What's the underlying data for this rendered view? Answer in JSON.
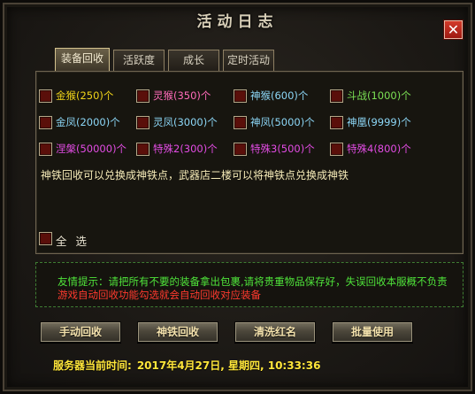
{
  "window": {
    "title": "活动日志",
    "close_label": "✕"
  },
  "tabs": [
    {
      "label": "装备回收",
      "active": true
    },
    {
      "label": "活跃度",
      "active": false
    },
    {
      "label": "成长",
      "active": false
    },
    {
      "label": "定时活动",
      "active": false
    }
  ],
  "items": [
    {
      "label": "金猴(250)个",
      "color": "#f0d419",
      "checked": false
    },
    {
      "label": "灵猴(350)个",
      "color": "#ff6bb9",
      "checked": false
    },
    {
      "label": "神猴(600)个",
      "color": "#8cd6f6",
      "checked": false
    },
    {
      "label": "斗战(1000)个",
      "color": "#7be054",
      "checked": false
    },
    {
      "label": "金凤(2000)个",
      "color": "#8cd6f6",
      "checked": false
    },
    {
      "label": "灵凤(3000)个",
      "color": "#8cd6f6",
      "checked": false
    },
    {
      "label": "神凤(5000)个",
      "color": "#8cd6f6",
      "checked": false
    },
    {
      "label": "神凰(9999)个",
      "color": "#8cd6f6",
      "checked": false
    },
    {
      "label": "涅槃(50000)个",
      "color": "#e34ce4",
      "checked": false
    },
    {
      "label": "特殊2(300)个",
      "color": "#e34ce4",
      "checked": false
    },
    {
      "label": "特殊3(500)个",
      "color": "#e34ce4",
      "checked": false
    },
    {
      "label": "特殊4(800)个",
      "color": "#e34ce4",
      "checked": false
    }
  ],
  "note": "神铁回收可以兑换成神铁点，武器店二楼可以将神铁点兑换成神铁",
  "select_all": {
    "label": "全 选",
    "checked": false
  },
  "tips": {
    "line1": "友情提示：请把所有不要的装备拿出包裹,请将贵重物品保存好，失误回收本服概不负责",
    "line2": "游戏自动回收功能勾选就会自动回收对应装备"
  },
  "buttons": {
    "manual_recycle": "手动回收",
    "iron_recycle": "神铁回收",
    "clear_red": "清洗红名",
    "batch_use": "批量使用"
  },
  "server_time": {
    "label": "服务器当前时间:",
    "value": "2017年4月27日, 星期四, 10:33:36"
  }
}
